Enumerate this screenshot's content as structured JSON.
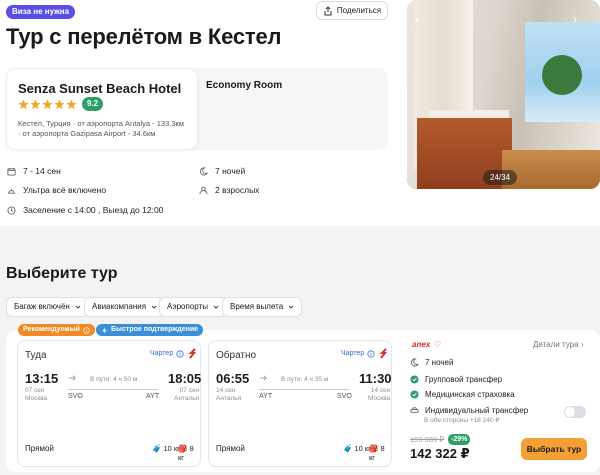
{
  "header": {
    "visa_badge": "Виза не нужна",
    "share_label": "Поделиться",
    "title": "Тур с перелётом в Кестел"
  },
  "hotel": {
    "name": "Senza Sunset Beach Hotel",
    "stars": 5,
    "rating": "9.2",
    "location": "Кестел, Турция",
    "airport1": "· от аэропорта Antalya - 133.3км",
    "airport2": "· от аэропорта Gazipasa Airport - 34.6км",
    "room": "Economy Room"
  },
  "info": {
    "dates": "7 - 14 сен",
    "nights": "7 ночей",
    "meal": "Ультра всё включено",
    "guests": "2 взрослых",
    "checkin": "Заселение с 14:00 , Выезд до 12:00"
  },
  "photo": {
    "counter": "24/34"
  },
  "tours": {
    "heading": "Выберите тур",
    "filters": [
      "Багаж включён",
      "Авиакомпания",
      "Аэропорты",
      "Время вылета"
    ],
    "tags": [
      "Рекомендуемый",
      "Быстрое подтверждение"
    ]
  },
  "outbound": {
    "direction": "Туда",
    "charter": "Чартер",
    "dep_time": "13:15",
    "dep_date": "07 сен",
    "dep_city": "Москва",
    "duration": "В пути: 4 ч 50 м",
    "dep_code": "SVO",
    "arr_code": "AYT",
    "arr_time": "18:05",
    "arr_date": "07 сен",
    "arr_city": "Анталья",
    "type": "Прямой",
    "bag1": "10 кг",
    "bag2": "8 кг"
  },
  "return": {
    "direction": "Обратно",
    "charter": "Чартер",
    "dep_time": "06:55",
    "dep_date": "14 сен",
    "dep_city": "Анталья",
    "duration": "В пути: 4 ч 35 м",
    "dep_code": "AYT",
    "arr_code": "SVO",
    "arr_time": "11:30",
    "arr_date": "14 сен",
    "arr_city": "Москва",
    "type": "Прямой",
    "bag1": "10 кг",
    "bag2": "8 кг"
  },
  "offer": {
    "provider": "anex",
    "details": "Детали тура",
    "nights": "7 ночей",
    "transfer": "Групповой трансфер",
    "insurance": "Медицинская страховка",
    "individual": "Индивидуальный трансфер",
    "individual_note": "В обе стороны +18 240 ₽",
    "old_price": "199 989 ₽",
    "discount": "-29%",
    "price": "142 322 ₽",
    "book": "Выбрать тур"
  },
  "colors": {
    "accent": "#5b4ee8",
    "green": "#2e9e6b",
    "orange": "#f5a036",
    "star": "#f5a623"
  }
}
